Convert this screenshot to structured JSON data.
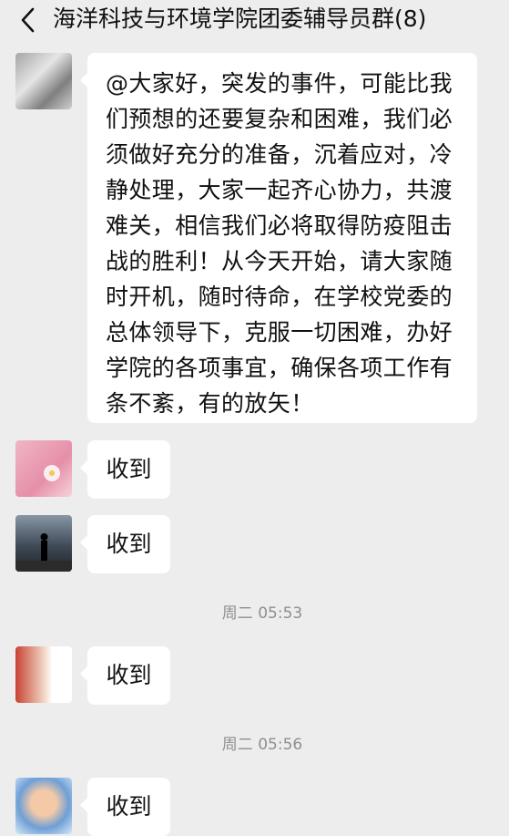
{
  "header": {
    "title": "海洋科技与环境学院团委辅导员群(8)",
    "back_icon": "chevron-left-icon"
  },
  "messages": [
    {
      "text": "@大家好，突发的事件，可能比我们预想的还要复杂和困难，我们必须做好充分的准备，沉着应对，冷静处理，大家一起齐心协力，共渡难关，相信我们必将取得防疫阻击战的胜利！从今天开始，请大家随时开机，随时待命，在学校党委的总体领导下，克服一切困难，办好学院的各项事宜，确保各项工作有条不紊，有的放矢！"
    },
    {
      "text": "收到"
    },
    {
      "text": "收到"
    },
    {
      "text": "收到"
    },
    {
      "text": "收到"
    }
  ],
  "timestamps": [
    {
      "day": "周二",
      "time": "05:53"
    },
    {
      "day": "周二",
      "time": "05:56"
    }
  ],
  "colors": {
    "background": "#ededed",
    "bubble": "#ffffff",
    "timestamp": "#8f8f8f"
  }
}
